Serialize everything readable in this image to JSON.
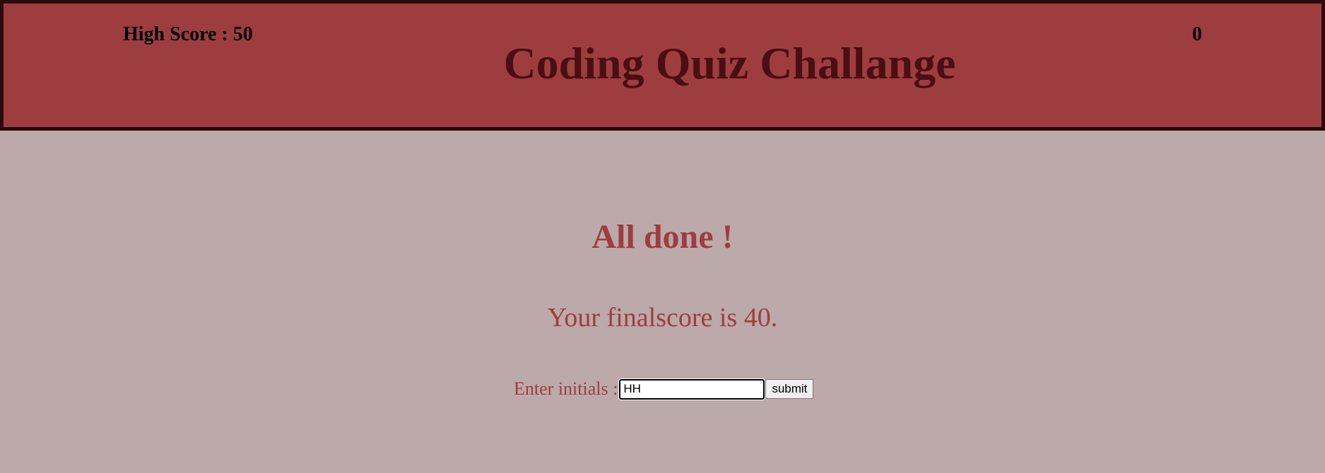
{
  "header": {
    "high_score_label": "High Score : 50",
    "timer_value": "0",
    "title": "Coding Quiz Challange"
  },
  "main": {
    "heading": "All done !",
    "final_score_text": "Your finalscore is 40.",
    "initials_label": "Enter initials :",
    "initials_value": "HH",
    "submit_label": "submit"
  },
  "colors": {
    "header_bg": "#9e3d3f",
    "header_border": "#2a0a0b",
    "title_text": "#4a0f10",
    "page_bg": "#bca9aa",
    "accent_text": "#9e3d3f"
  }
}
